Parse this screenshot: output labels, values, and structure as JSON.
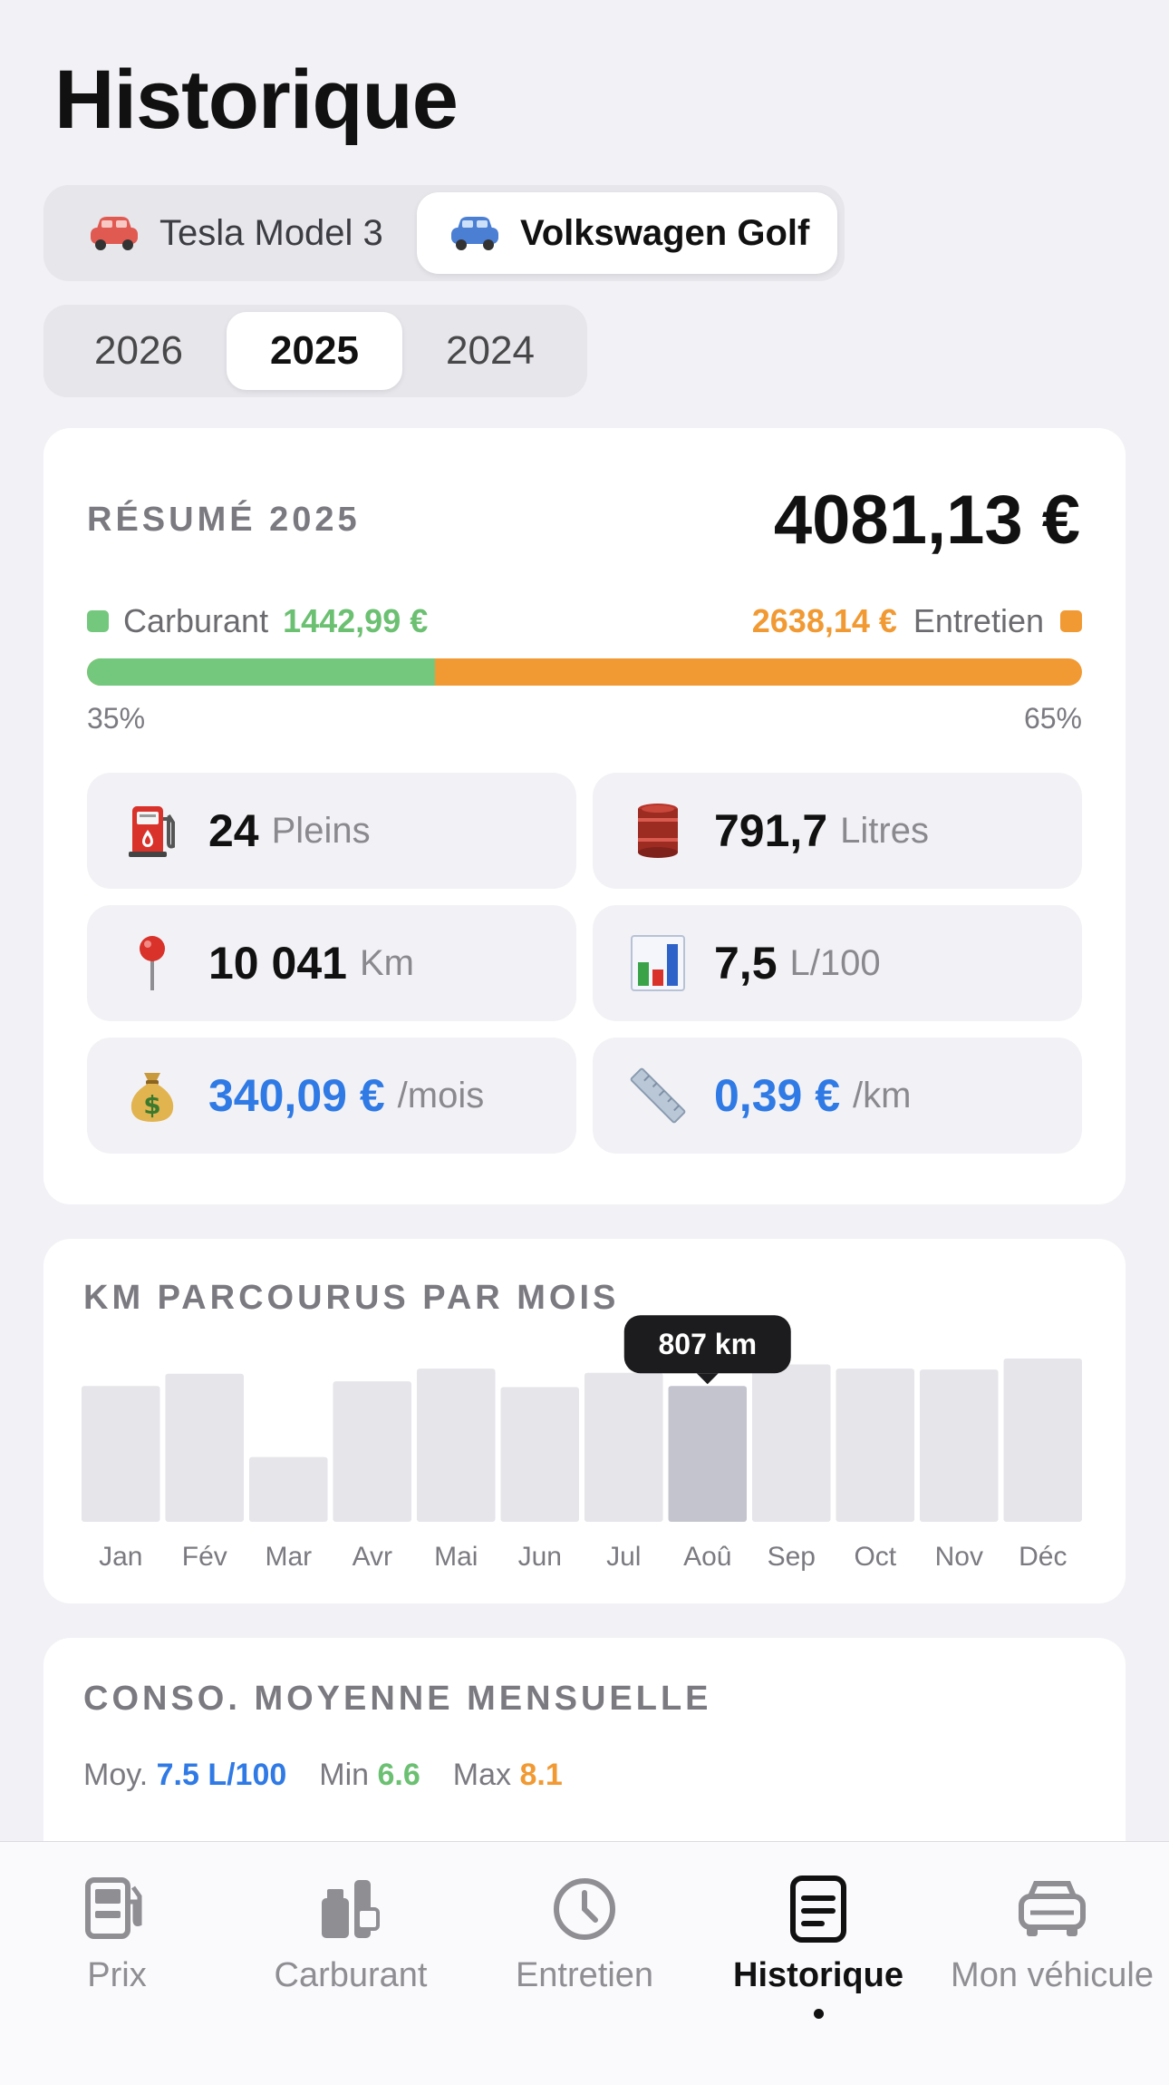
{
  "page": {
    "title": "Historique"
  },
  "vehicle_selector": {
    "options": [
      {
        "label": "Tesla Model 3",
        "color": "#e05a52",
        "selected": false
      },
      {
        "label": "Volkswagen Golf",
        "color": "#4a7fd4",
        "selected": true
      }
    ]
  },
  "year_selector": {
    "options": [
      {
        "label": "2026",
        "selected": false
      },
      {
        "label": "2025",
        "selected": true
      },
      {
        "label": "2024",
        "selected": false
      }
    ]
  },
  "summary": {
    "label": "RÉSUMÉ 2025",
    "total": "4081,13 €",
    "fuel_label": "Carburant",
    "fuel_value": "1442,99 €",
    "maintenance_label": "Entretien",
    "maintenance_value": "2638,14 €",
    "fuel_fraction": 0.35,
    "fuel_pct": "35%",
    "maintenance_pct": "65%",
    "colors": {
      "fuel": "#74c87d",
      "maintenance": "#f19a34"
    },
    "stats": [
      {
        "icon": "fuel-pump-icon",
        "value": "24",
        "unit": "Pleins",
        "accent": false
      },
      {
        "icon": "oil-barrel-icon",
        "value": "791,7",
        "unit": "Litres",
        "accent": false
      },
      {
        "icon": "pushpin-icon",
        "value": "10 041",
        "unit": "Km",
        "accent": false
      },
      {
        "icon": "bar-chart-icon",
        "value": "7,5",
        "unit": "L/100",
        "accent": false
      },
      {
        "icon": "money-bag-icon",
        "value": "340,09 €",
        "unit": "/mois",
        "accent": true
      },
      {
        "icon": "ruler-icon",
        "value": "0,39 €",
        "unit": "/km",
        "accent": true
      }
    ]
  },
  "km_chart": {
    "title": "KM PARCOURUS PAR MOIS",
    "tooltip": "807 km",
    "highlighted_index": 7
  },
  "chart_data": {
    "type": "bar",
    "categories": [
      "Jan",
      "Fév",
      "Mar",
      "Avr",
      "Mai",
      "Jun",
      "Jul",
      "Aoû",
      "Sep",
      "Oct",
      "Nov",
      "Déc"
    ],
    "values": [
      807,
      880,
      385,
      835,
      910,
      800,
      885,
      807,
      935,
      910,
      905,
      970
    ],
    "title": "KM PARCOURUS PAR MOIS",
    "xlabel": "",
    "ylabel": "",
    "ylim": [
      0,
      970
    ],
    "grid": false,
    "colors": {
      "bar": "#e5e5ea",
      "highlight": "#c4c4cf"
    }
  },
  "conso": {
    "title": "CONSO. MOYENNE MENSUELLE",
    "avg_label": "Moy.",
    "avg_value": "7.5 L/100",
    "min_label": "Min",
    "min_value": "6.6",
    "max_label": "Max",
    "max_value": "8.1"
  },
  "tabbar": {
    "tabs": [
      {
        "label": "Prix",
        "icon": "fuel-station-icon",
        "active": false
      },
      {
        "label": "Carburant",
        "icon": "fuel-can-icon",
        "active": false
      },
      {
        "label": "Entretien",
        "icon": "clock-icon",
        "active": false
      },
      {
        "label": "Historique",
        "icon": "document-icon",
        "active": true
      },
      {
        "label": "Mon véhicule",
        "icon": "car-icon",
        "active": false
      }
    ]
  }
}
